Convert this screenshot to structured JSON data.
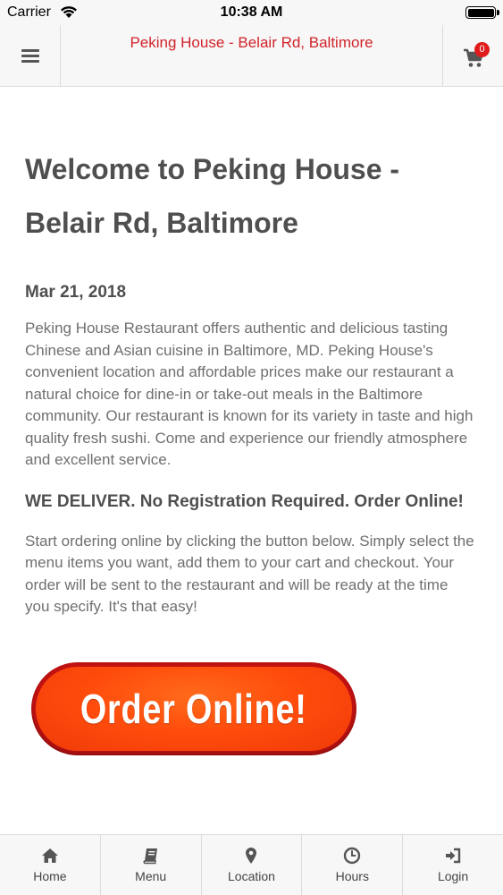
{
  "status_bar": {
    "carrier": "Carrier",
    "time": "10:38 AM"
  },
  "header": {
    "title": "Peking House - Belair Rd, Baltimore",
    "cart_count": "0",
    "title_color": "#d2232a"
  },
  "content": {
    "title": "Welcome to Peking House - Belair Rd, Baltimore",
    "date": "Mar 21, 2018",
    "intro": "Peking House Restaurant offers authentic and delicious tasting Chinese and Asian cuisine in Baltimore, MD.  Peking House's convenient location and affordable prices make our restaurant a natural choice for dine-in or  take-out meals in the Baltimore community. Our restaurant is known for its variety in taste and high quality fresh sushi. Come and experience our friendly atmosphere and excellent service.",
    "deliver_heading": "WE DELIVER. No Registration Required. Order Online!",
    "instructions": "Start ordering online by clicking the button below. Simply select the menu items you want, add them to your cart and checkout. Your order will be sent to the restaurant and will be ready at the time you specify. It's that easy!",
    "order_button": "Order Online!"
  },
  "tabs": [
    {
      "label": "Home",
      "icon": "home-icon"
    },
    {
      "label": "Menu",
      "icon": "book-icon"
    },
    {
      "label": "Location",
      "icon": "map-marker-icon"
    },
    {
      "label": "Hours",
      "icon": "clock-icon"
    },
    {
      "label": "Login",
      "icon": "login-icon"
    }
  ]
}
